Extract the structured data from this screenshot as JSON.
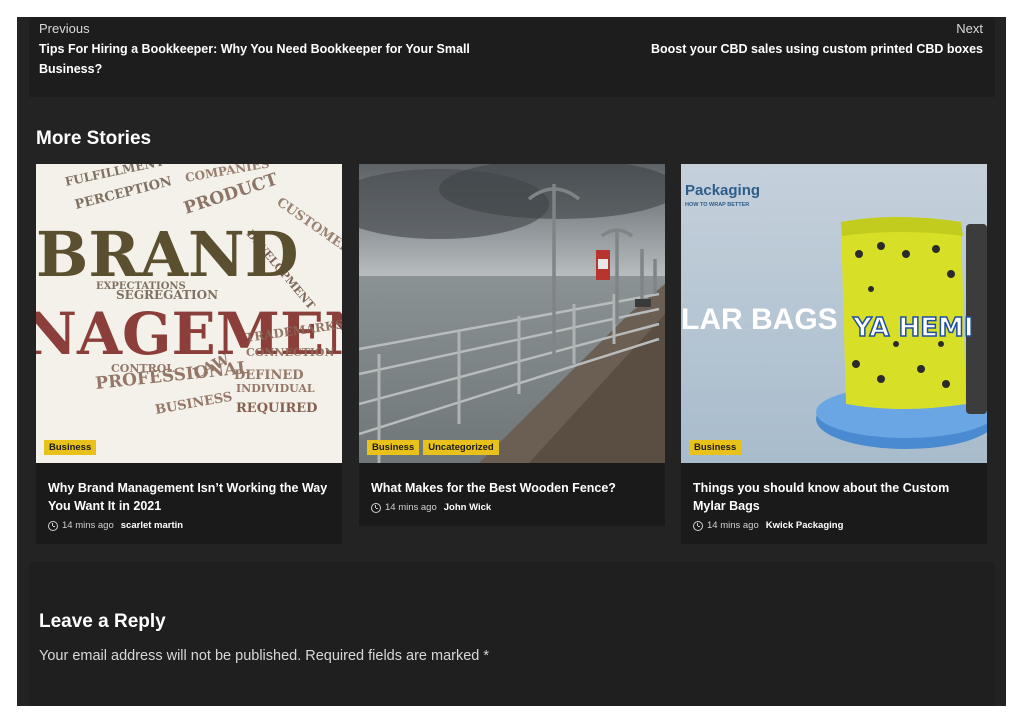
{
  "post_navigation": {
    "previous_caption": "Previous",
    "previous_title": "Tips For Hiring a Bookkeeper: Why You Need Bookkeeper for Your Small Business?",
    "next_caption": "Next",
    "next_title": "Boost your CBD sales using custom printed CBD boxes"
  },
  "more_stories": {
    "heading": "More Stories",
    "cards": [
      {
        "image": "brand-management-word-cloud",
        "categories": [
          "Business"
        ],
        "title": "Why Brand Management Isn’t Working the Way You Want It in 2021",
        "time": "14 mins ago",
        "author": "scarlet martin"
      },
      {
        "image": "pier-with-lamp-posts",
        "categories": [
          "Business",
          "Uncategorized"
        ],
        "title": "What Makes for the Best Wooden Fence?",
        "time": "14 mins ago",
        "author": "John Wick"
      },
      {
        "image": "mylar-bags-packaging",
        "categories": [
          "Business"
        ],
        "title": "Things you should know about the Custom Mylar Bags",
        "time": "14 mins ago",
        "author": "Kwick Packaging"
      }
    ]
  },
  "image_text": {
    "brand_line1": "BRAND",
    "brand_line2": "NAGEMEN",
    "brand_words": [
      "FULFILLMENT",
      "COMPANIES",
      "PERCEPTION",
      "PRODUCT",
      "CUSTOMER",
      "EXPECTATIONS",
      "SEGREGATION",
      "PROFESSIONAL",
      "CONTROL",
      "REQUIRED",
      "BUSINESS",
      "LAW",
      "DEFINED",
      "INDIVIDUAL",
      "CONNECTION",
      "TRADEMARKS",
      "DEVELOPMENT"
    ],
    "packaging_label": "Packaging",
    "packaging_sub": "HOW TO WRAP BETTER",
    "mylar_text": "LAR BAGS",
    "bag_brand": "YA HEMI"
  },
  "reply": {
    "heading": "Leave a Reply",
    "note": "Your email address will not be published. Required fields are marked *"
  },
  "colors": {
    "category_badge": "#e8c11a",
    "background": "#232323"
  }
}
